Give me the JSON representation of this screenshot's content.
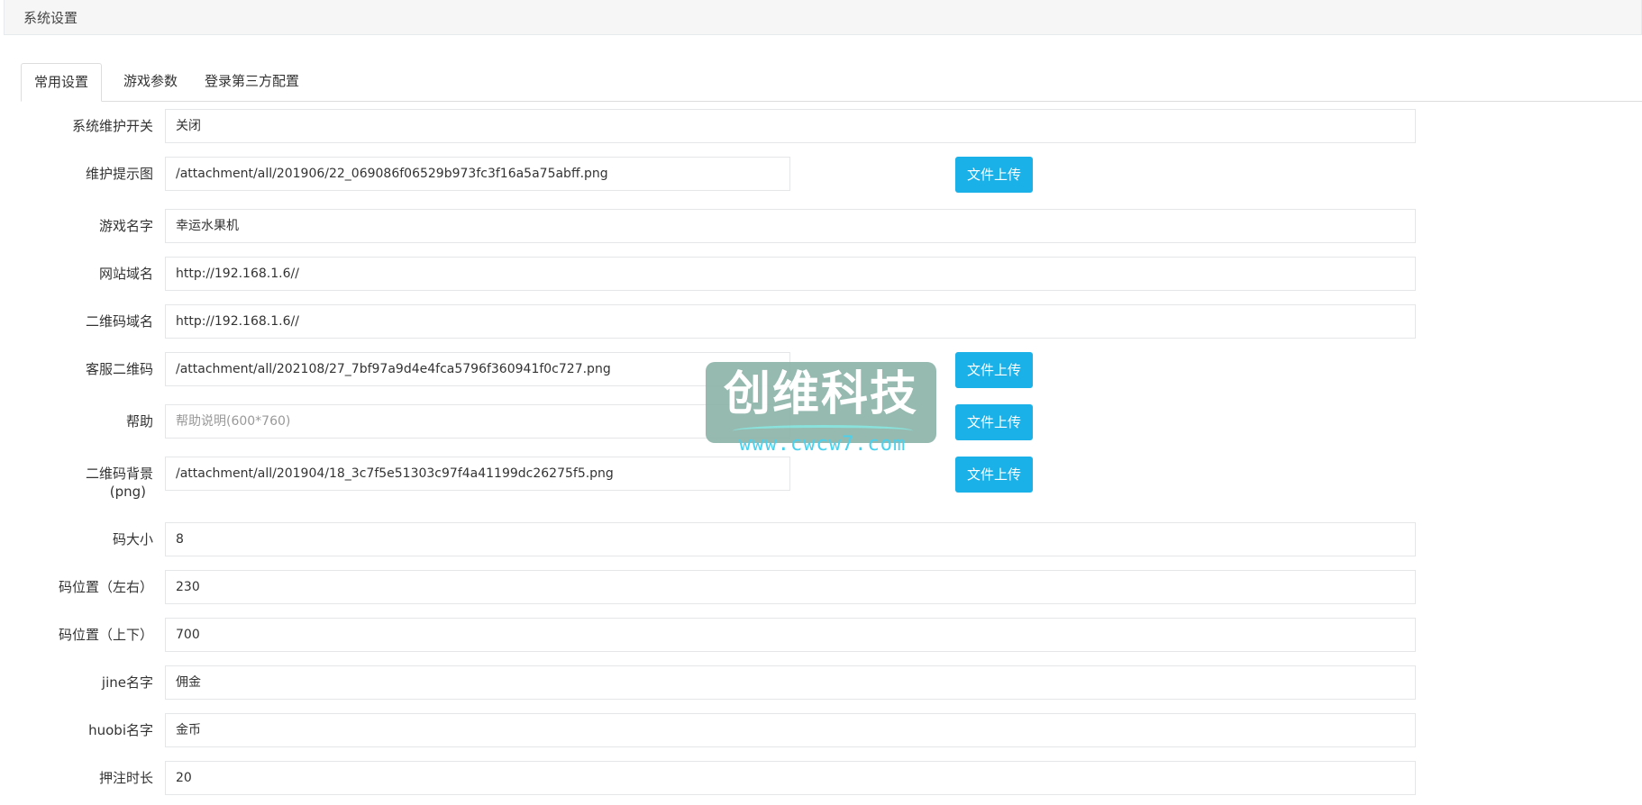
{
  "header": {
    "title": "系统设置"
  },
  "tabs": [
    {
      "label": "常用设置"
    },
    {
      "label": "游戏参数"
    },
    {
      "label": "登录第三方配置"
    }
  ],
  "upload_label": "文件上传",
  "fields": {
    "maintenance": {
      "label": "系统维护开关",
      "value": "关闭"
    },
    "maintenance_image": {
      "label": "维护提示图",
      "value": "/attachment/all/201906/22_069086f06529b973fc3f16a5a75abff.png"
    },
    "game_name": {
      "label": "游戏名字",
      "value": "幸运水果机"
    },
    "site_domain": {
      "label": "网站域名",
      "value": "http://192.168.1.6//"
    },
    "qr_domain": {
      "label": "二维码域名",
      "value": "http://192.168.1.6//"
    },
    "service_qr": {
      "label": "客服二维码",
      "value": "/attachment/all/202108/27_7bf97a9d4e4fca5796f360941f0c727.png"
    },
    "help": {
      "label": "帮助",
      "placeholder": "帮助说明(600*760)"
    },
    "qr_background": {
      "label_line1": "二维码背景",
      "label_line2": "(png)",
      "value": "/attachment/all/201904/18_3c7f5e51303c97f4a41199dc26275f5.png"
    },
    "code_size": {
      "label": "码大小",
      "value": "8"
    },
    "code_pos_x": {
      "label": "码位置（左右）",
      "value": "230"
    },
    "code_pos_y": {
      "label": "码位置（上下）",
      "value": "700"
    },
    "jine_name": {
      "label": "jine名字",
      "value": "佣金"
    },
    "huobi_name": {
      "label": "huobi名字",
      "value": "金币"
    },
    "bet_duration": {
      "label": "押注时长",
      "value": "20"
    }
  },
  "watermark": {
    "title": "创维科技",
    "url": "www.cwcw7.com"
  },
  "colors": {
    "accent": "#1ab0e8",
    "border": "#e5e6e7"
  }
}
